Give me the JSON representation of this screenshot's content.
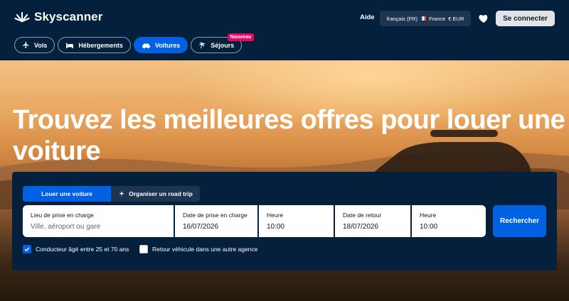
{
  "brand": {
    "name": "Skyscanner"
  },
  "header": {
    "help_label": "Aide",
    "locale": {
      "language": "français (FR)",
      "country": "France",
      "currency": "€ EUR"
    },
    "login_label": "Se connecter"
  },
  "nav": {
    "tabs": [
      {
        "label": "Vols",
        "icon": "plane-icon"
      },
      {
        "label": "Hébergements",
        "icon": "bed-icon"
      },
      {
        "label": "Voitures",
        "icon": "car-icon",
        "active": true
      },
      {
        "label": "Séjours",
        "icon": "palm-icon",
        "badge": "Nouveau"
      }
    ]
  },
  "hero": {
    "headline": "Trouvez les meilleures offres pour louer une voiture"
  },
  "search": {
    "modes": [
      {
        "label": "Louer une voiture",
        "active": true
      },
      {
        "label": "Organiser un road trip",
        "icon": "sparkle-icon"
      }
    ],
    "pickup_location": {
      "label": "Lieu de prise en charge",
      "placeholder": "Ville, aéroport ou gare"
    },
    "pickup_date": {
      "label": "Date de prise en charge",
      "value": "16/07/2026"
    },
    "pickup_time": {
      "label": "Heure",
      "value": "10:00"
    },
    "return_date": {
      "label": "Date de retour",
      "value": "18/07/2026"
    },
    "return_time": {
      "label": "Heure",
      "value": "10:00"
    },
    "submit_label": "Rechercher",
    "options": {
      "driver_age": {
        "label": "Conducteur âgé entre 25 et 70 ans",
        "checked": true
      },
      "different_return": {
        "label": "Retour véhicule dans une autre agence",
        "checked": false
      }
    }
  },
  "colors": {
    "navy": "#05203c",
    "accent": "#0062e3",
    "badge": "#e70866"
  }
}
